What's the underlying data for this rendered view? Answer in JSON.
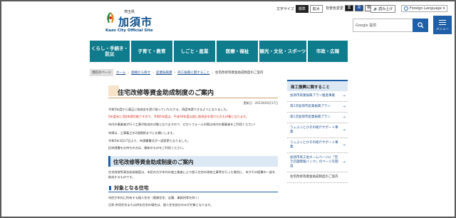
{
  "header": {
    "logo_pref": "埼玉県",
    "logo_name": "加須市",
    "logo_sub": "Kazo City Official Site",
    "text_size_label": "文字サイズ",
    "text_size_standard": "標準",
    "text_size_large": "拡大",
    "bg_color_label": "背景色変更",
    "bg_black": "黒",
    "bg_blue": "青",
    "bg_standard": "標準",
    "read_aloud": "読み上げ",
    "language": "Foreign Language",
    "search_brand": "Google 提供",
    "search_placeholder": "",
    "menu_label": "メニュー",
    "colors": {
      "brand_blue": "#1e5fa8",
      "nav_teal": "#0e7c8c"
    }
  },
  "nav": [
    "くらし・手続き・防災",
    "子育て・教育",
    "しごと・産業",
    "医療・福祉",
    "観光・文化・スポーツ",
    "市政・広報"
  ],
  "breadcrumb": {
    "here": "現在のページ",
    "items": [
      "ホーム",
      "組織から探す",
      "産業振興課",
      "商工振興に関すること",
      "住宅改修等資金助成制度のご案内"
    ]
  },
  "main": {
    "title": "住宅改修等資金助成制度のご案内",
    "updated": "更新日：2023年05月17日",
    "p1": "令和5年度から適正に助成金を受け取っていただける、再度申請できるようになりました。",
    "p_red": "5年度末に3回申請可能ですので、令和5年度は、平成30年度以前に助成金を受けた方も対象になります。",
    "p2": "市内の事業者が行う工事が助成の対象となりますので、ぜひリフォームの際は市内の事業者をご利用ください！",
    "p3": "申請は、工事着工の2週間前までにお願いします。",
    "p4": "令和5年3月17日より、申請書書式が一部変更となりました。",
    "p5": "旧申請書をお持ちの方は、最新のものをご利用ください。",
    "h2": "住宅改修等資金助成制度のご案内",
    "p6": "住宅改修等資金助成制度は、市民の方が市内の施工業者により個人住宅の改修工事等を行った場合に、市がその経費の一部を助成するものです。",
    "h3": "対象となる住宅",
    "p7": "市民が市内に所有する個人住宅（賃貸住宅、店舗、事務所等を除く）",
    "p8": "注釈 併用住宅または併存住宅の場合は、個人住宅部分のみが対象となります。"
  },
  "sidebar": {
    "heading": "商工振興に関すること",
    "items": [
      "加須市商業振興プラン推進事業",
      "第2次加須市産業振興プラン",
      "第1次加須市産業振興プラン",
      "うぇぶっとかぞの紹介サポート事業",
      "うぇぶっとかぞの紹介サポート事業",
      "加須市商工会ホームページに「空き店舗情報バンク」のページを開設",
      "住宅改修等資金助成制度のご案内"
    ]
  }
}
